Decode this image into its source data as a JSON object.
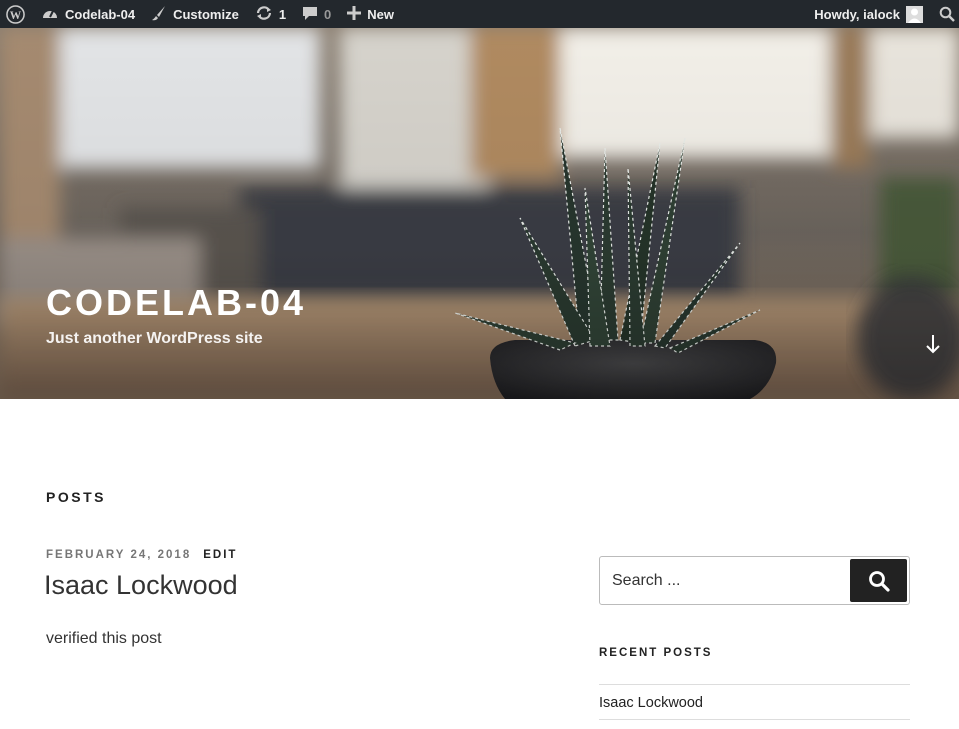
{
  "adminbar": {
    "site_name": "Codelab-04",
    "customize": "Customize",
    "updates_count": "1",
    "comments_count": "0",
    "new_label": "New",
    "greeting": "Howdy, ialock"
  },
  "header": {
    "site_title": "CODELAB-04",
    "tagline": "Just another WordPress site"
  },
  "main": {
    "posts_heading": "POSTS",
    "post": {
      "date": "FEBRUARY 24, 2018",
      "edit_label": "EDIT",
      "title": "Isaac Lockwood",
      "excerpt": "verified this post"
    }
  },
  "sidebar": {
    "search_placeholder": "Search ...",
    "recent_title": "RECENT POSTS",
    "recent_posts": [
      "Isaac Lockwood"
    ]
  },
  "colors": {
    "adminbar_bg": "#23282d",
    "search_button_bg": "#222222"
  }
}
